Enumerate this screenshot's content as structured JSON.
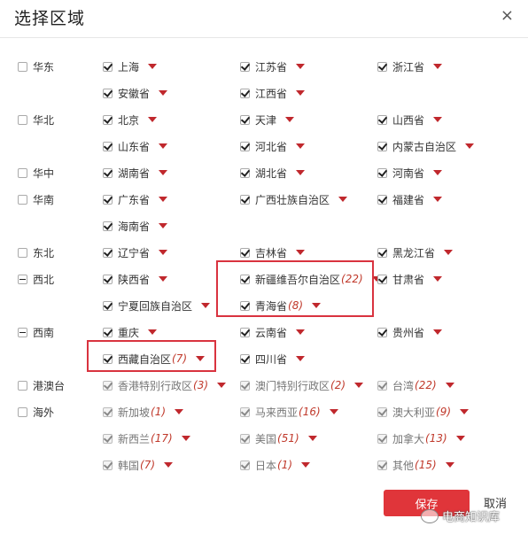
{
  "dialog": {
    "title": "选择区域",
    "close_icon": "×"
  },
  "regions": [
    {
      "name": "华东",
      "state": "unchecked",
      "items": [
        {
          "label": "上海",
          "count": "",
          "state": "unchecked"
        },
        {
          "label": "江苏省",
          "count": "",
          "state": "unchecked"
        },
        {
          "label": "浙江省",
          "count": "",
          "state": "unchecked"
        },
        {
          "label": "安徽省",
          "count": "",
          "state": "unchecked"
        },
        {
          "label": "江西省",
          "count": "",
          "state": "unchecked"
        }
      ]
    },
    {
      "name": "华北",
      "state": "unchecked",
      "items": [
        {
          "label": "北京",
          "count": "",
          "state": "unchecked"
        },
        {
          "label": "天津",
          "count": "",
          "state": "unchecked"
        },
        {
          "label": "山西省",
          "count": "",
          "state": "unchecked"
        },
        {
          "label": "山东省",
          "count": "",
          "state": "unchecked"
        },
        {
          "label": "河北省",
          "count": "",
          "state": "unchecked"
        },
        {
          "label": "内蒙古自治区",
          "count": "",
          "state": "unchecked"
        }
      ]
    },
    {
      "name": "华中",
      "state": "unchecked",
      "items": [
        {
          "label": "湖南省",
          "count": "",
          "state": "unchecked"
        },
        {
          "label": "湖北省",
          "count": "",
          "state": "unchecked"
        },
        {
          "label": "河南省",
          "count": "",
          "state": "unchecked"
        }
      ]
    },
    {
      "name": "华南",
      "state": "unchecked",
      "items": [
        {
          "label": "广东省",
          "count": "",
          "state": "unchecked"
        },
        {
          "label": "广西壮族自治区",
          "count": "",
          "state": "unchecked"
        },
        {
          "label": "福建省",
          "count": "",
          "state": "unchecked"
        },
        {
          "label": "海南省",
          "count": "",
          "state": "unchecked"
        }
      ]
    },
    {
      "name": "东北",
      "state": "unchecked",
      "items": [
        {
          "label": "辽宁省",
          "count": "",
          "state": "unchecked"
        },
        {
          "label": "吉林省",
          "count": "",
          "state": "unchecked"
        },
        {
          "label": "黑龙江省",
          "count": "",
          "state": "unchecked"
        }
      ]
    },
    {
      "name": "西北",
      "state": "indeterminate",
      "items": [
        {
          "label": "陕西省",
          "count": "",
          "state": "unchecked"
        },
        {
          "label": "新疆维吾尔自治区",
          "count": "(22)",
          "state": "checked"
        },
        {
          "label": "甘肃省",
          "count": "",
          "state": "unchecked"
        },
        {
          "label": "宁夏回族自治区",
          "count": "",
          "state": "unchecked"
        },
        {
          "label": "青海省",
          "count": "(8)",
          "state": "checked"
        }
      ]
    },
    {
      "name": "西南",
      "state": "indeterminate",
      "items": [
        {
          "label": "重庆",
          "count": "",
          "state": "unchecked"
        },
        {
          "label": "云南省",
          "count": "",
          "state": "unchecked"
        },
        {
          "label": "贵州省",
          "count": "",
          "state": "unchecked"
        },
        {
          "label": "西藏自治区",
          "count": "(7)",
          "state": "checked"
        },
        {
          "label": "四川省",
          "count": "",
          "state": "unchecked"
        }
      ]
    },
    {
      "name": "港澳台",
      "state": "unchecked",
      "items": [
        {
          "label": "香港特别行政区",
          "count": "(3)",
          "state": "disabled-checked"
        },
        {
          "label": "澳门特别行政区",
          "count": "(2)",
          "state": "disabled-checked"
        },
        {
          "label": "台湾",
          "count": "(22)",
          "state": "disabled-checked"
        }
      ]
    },
    {
      "name": "海外",
      "state": "unchecked",
      "items": [
        {
          "label": "新加坡",
          "count": "(1)",
          "state": "disabled-checked"
        },
        {
          "label": "马来西亚",
          "count": "(16)",
          "state": "disabled-checked"
        },
        {
          "label": "澳大利亚",
          "count": "(9)",
          "state": "disabled-checked"
        },
        {
          "label": "新西兰",
          "count": "(17)",
          "state": "disabled-checked"
        },
        {
          "label": "美国",
          "count": "(51)",
          "state": "disabled-checked"
        },
        {
          "label": "加拿大",
          "count": "(13)",
          "state": "disabled-checked"
        },
        {
          "label": "韩国",
          "count": "(7)",
          "state": "disabled-checked"
        },
        {
          "label": "日本",
          "count": "(1)",
          "state": "disabled-checked"
        },
        {
          "label": "其他",
          "count": "(15)",
          "state": "disabled-checked"
        }
      ]
    }
  ],
  "footer": {
    "save_label": "保存",
    "cancel_label": "取消",
    "watermark": "电商知识库"
  },
  "colors": {
    "accent": "#e0353a",
    "arrow": "#c0282d",
    "highlight_box": "#d9333f",
    "count_text": "#c0392b"
  }
}
